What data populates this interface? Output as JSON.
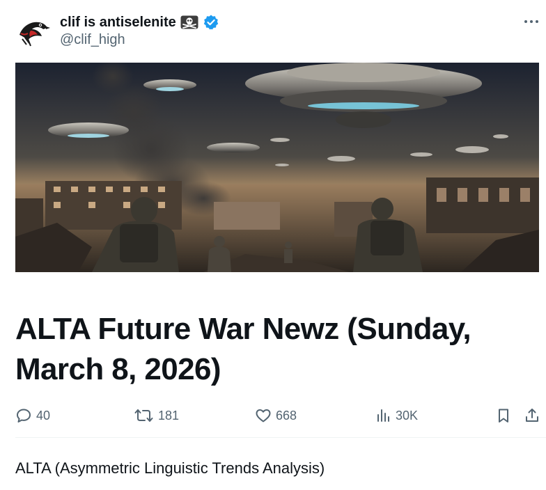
{
  "author": {
    "display_name": "clif is antiselenite",
    "handle": "@clif_high",
    "verified": true,
    "badge_icon": "skull-crossbones-icon",
    "verified_color": "#1d9bf0"
  },
  "media": {
    "icon": "ufo-war-scene-image"
  },
  "card": {
    "title": "ALTA Future War Newz (Sunday, March 8, 2026)"
  },
  "actions": {
    "replies": "40",
    "reposts": "181",
    "likes": "668",
    "views": "30K"
  },
  "body": {
    "text": "ALTA (Asymmetric Linguistic Trends Analysis)"
  },
  "colors": {
    "text": "#0f1419",
    "secondary": "#536471",
    "divider": "#eff3f4"
  }
}
